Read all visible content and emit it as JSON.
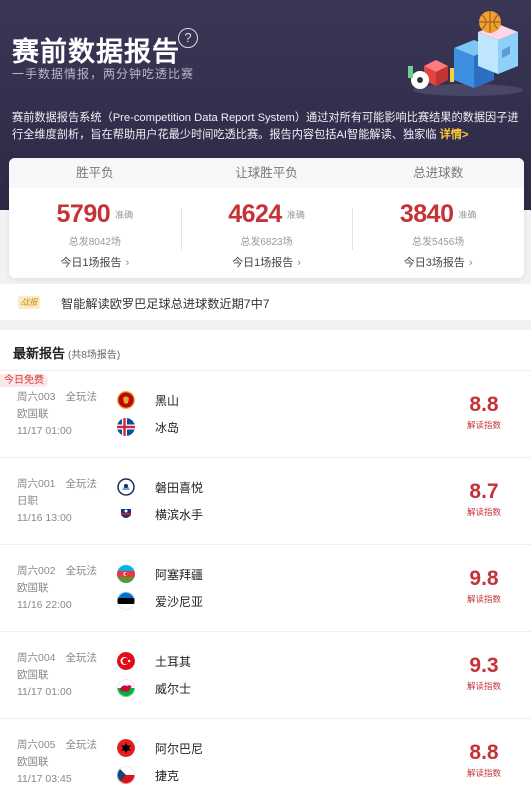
{
  "hero": {
    "title": "赛前数据报告",
    "subtitle": "一手数据情报，两分钟吃透比赛",
    "desc": "赛前数据报告系统（Pre-competition Data Report System）通过对所有可能影响比赛结果的数据因子进行全维度剖析，旨在帮助用户花最少时间吃透比赛。报告内容包括AI智能解读、独家临",
    "more": "详情>"
  },
  "stats": {
    "headers": [
      "胜平负",
      "让球胜平负",
      "总进球数"
    ],
    "columns": [
      {
        "value": "5790",
        "unit": "准确",
        "total": "总发8042场",
        "today": "今日1场报告"
      },
      {
        "value": "4624",
        "unit": "准确",
        "total": "总发6823场",
        "today": "今日1场报告"
      },
      {
        "value": "3840",
        "unit": "准确",
        "total": "总发5456场",
        "today": "今日3场报告"
      }
    ]
  },
  "notice": {
    "badge": "战报",
    "text": "智能解读欧罗巴足球总进球数近期7中7"
  },
  "latest": {
    "title": "最新报告",
    "count": "(共8场报告)",
    "matches": [
      {
        "free": "今日免费",
        "code": "周六003",
        "play": "全玩法",
        "league": "欧国联",
        "time": "11/17 01:00",
        "home": "黑山",
        "away": "冰岛",
        "score": "8.8",
        "score_label": "解读指数",
        "home_flag": "montenegro",
        "away_flag": "iceland"
      },
      {
        "free": "",
        "code": "周六001",
        "play": "全玩法",
        "league": "日职",
        "time": "11/16 13:00",
        "home": "磐田喜悦",
        "away": "横滨水手",
        "score": "8.7",
        "score_label": "解读指数",
        "home_flag": "jubilo-badge",
        "away_flag": "marinos-badge"
      },
      {
        "free": "",
        "code": "周六002",
        "play": "全玩法",
        "league": "欧国联",
        "time": "11/16 22:00",
        "home": "阿塞拜疆",
        "away": "爱沙尼亚",
        "score": "9.8",
        "score_label": "解读指数",
        "home_flag": "azerbaijan",
        "away_flag": "estonia"
      },
      {
        "free": "",
        "code": "周六004",
        "play": "全玩法",
        "league": "欧国联",
        "time": "11/17 01:00",
        "home": "土耳其",
        "away": "威尔士",
        "score": "9.3",
        "score_label": "解读指数",
        "home_flag": "turkey",
        "away_flag": "wales"
      },
      {
        "free": "",
        "code": "周六005",
        "play": "全玩法",
        "league": "欧国联",
        "time": "11/17 03:45",
        "home": "阿尔巴尼",
        "away": "捷克",
        "score": "8.8",
        "score_label": "解读指数",
        "home_flag": "albania",
        "away_flag": "czech"
      }
    ]
  },
  "colors": {
    "accent_red": "#c53238",
    "hero_bg": "#2c2a45",
    "link_yellow": "#ffc93a"
  }
}
